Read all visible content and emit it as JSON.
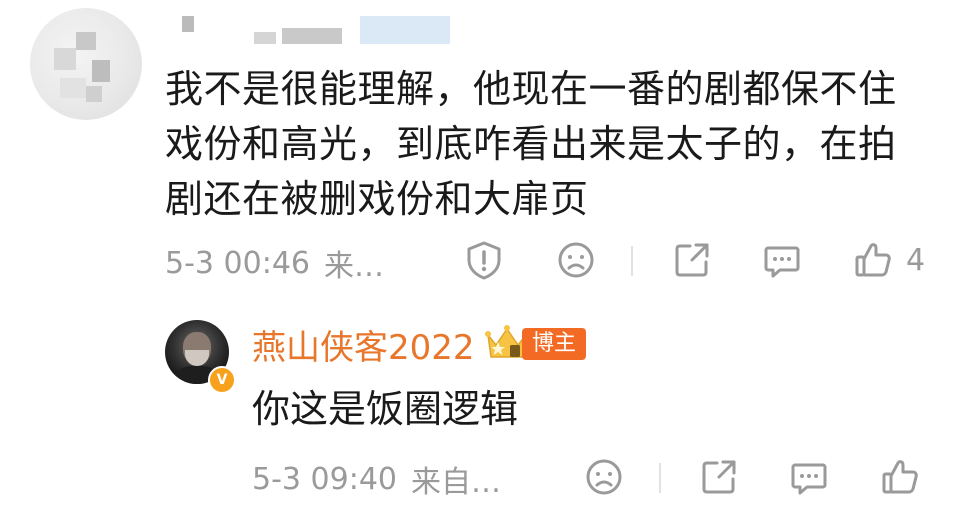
{
  "comment": {
    "text_lines": [
      "我不是很能理解，他现在一番的剧都保不住",
      "戏份和高光，到底咋看出来是太子的，在拍",
      "剧还在被删戏份和大扉页"
    ],
    "time": "5-3 00:46",
    "source": "来…",
    "like_count": "4"
  },
  "reply": {
    "author": "燕山侠客2022",
    "badge": "博主",
    "verified_mark": "V",
    "text": "你这是饭圈逻辑",
    "time": "5-3 09:40",
    "source": "来自…"
  },
  "icons": {
    "report": "alert-circle-icon",
    "dislike": "sad-face-icon",
    "share": "share-icon",
    "comment": "comment-icon",
    "like": "thumbs-up-icon"
  },
  "colors": {
    "author_name": "#e8762b",
    "badge_bg": "#f36a24",
    "verified_badge": "#f7a11c",
    "meta_text": "#9a9a9a",
    "body_text": "#1a1a1a"
  }
}
